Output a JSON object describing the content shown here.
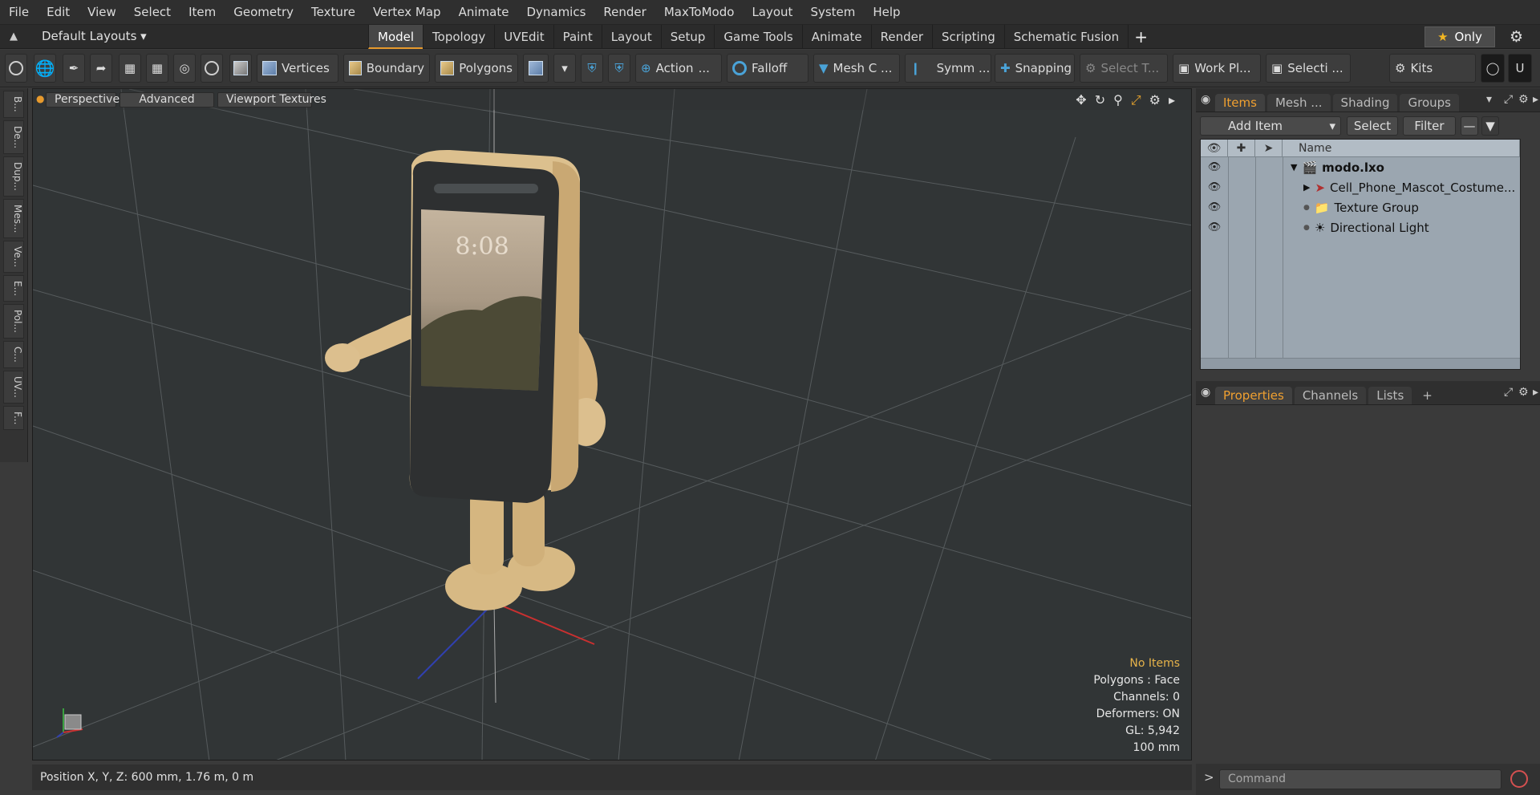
{
  "menubar": [
    "File",
    "Edit",
    "View",
    "Select",
    "Item",
    "Geometry",
    "Texture",
    "Vertex Map",
    "Animate",
    "Dynamics",
    "Render",
    "MaxToModo",
    "Layout",
    "System",
    "Help"
  ],
  "layoutbar": {
    "layout_name": "Default Layouts",
    "tabs": [
      "Model",
      "Topology",
      "UVEdit",
      "Paint",
      "Layout",
      "Setup",
      "Game Tools",
      "Animate",
      "Render",
      "Scripting",
      "Schematic Fusion"
    ],
    "active_tab": "Model",
    "only_label": "Only"
  },
  "toolbar": {
    "vertices": "Vertices",
    "boundary": "Boundary",
    "polygons": "Polygons",
    "action": "Action",
    "falloff": "Falloff",
    "mesh": "Mesh C ...",
    "symm": "Symm ...",
    "snapping": "Snapping",
    "select_t": "Select T...",
    "workplane": "Work Pl...",
    "selecti": "Selecti ...",
    "kits": "Kits"
  },
  "leftstrip": [
    "B...",
    "De...",
    "Dup...",
    "Mes...",
    "Ve...",
    "E...",
    "Pol...",
    "C...",
    "UV...",
    "F..."
  ],
  "viewport": {
    "perspective": "Perspective",
    "advanced": "Advanced",
    "viewport_textures": "Viewport Textures",
    "screen_time": "8:08",
    "info": {
      "no_items": "No Items",
      "polygons": "Polygons : Face",
      "channels": "Channels: 0",
      "deformers": "Deformers: ON",
      "gl": "GL: 5,942",
      "scale": "100 mm"
    }
  },
  "statusbar": {
    "position": "Position X, Y, Z:  600 mm, 1.76 m, 0 m"
  },
  "items_panel": {
    "tabs": [
      "Items",
      "Mesh ...",
      "Shading",
      "Groups"
    ],
    "active_tab": "Items",
    "add_item": "Add Item",
    "select": "Select",
    "filter": "Filter",
    "column_name": "Name",
    "rows": [
      {
        "name": "modo.lxo"
      },
      {
        "name": "Cell_Phone_Mascot_Costume..."
      },
      {
        "name": "Texture Group"
      },
      {
        "name": "Directional Light"
      }
    ]
  },
  "properties_panel": {
    "tabs": [
      "Properties",
      "Channels",
      "Lists"
    ],
    "active_tab": "Properties"
  },
  "command": {
    "placeholder": "Command"
  },
  "colors": {
    "accent": "#e79a2d",
    "viewport_bg": "#313536",
    "item_list_bg": "#9ba6b0",
    "mascot_body": "#dcbf8e",
    "screen_frame": "#2e3031"
  }
}
